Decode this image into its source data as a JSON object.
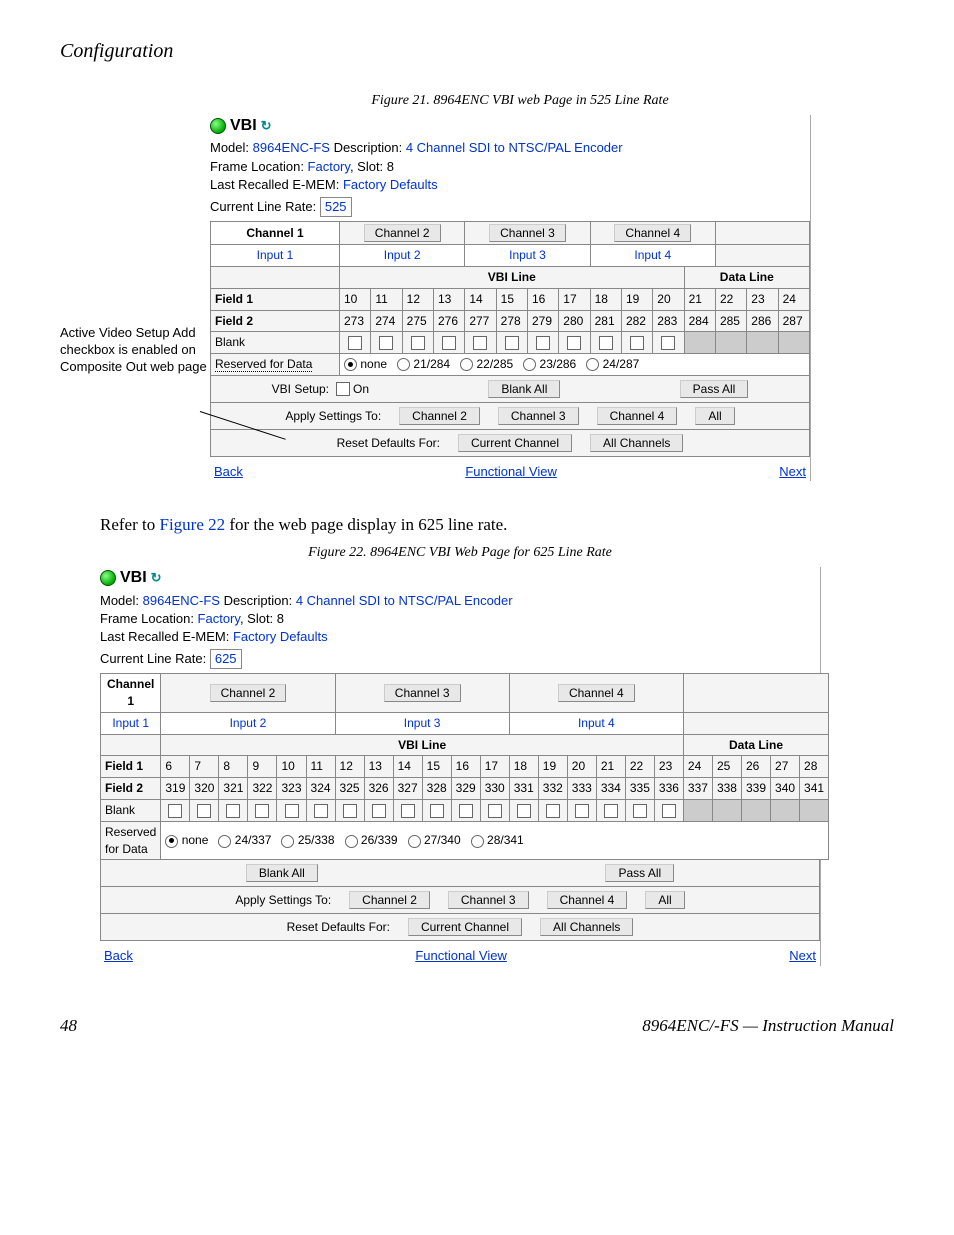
{
  "page": {
    "section": "Configuration",
    "page_num": "48",
    "manual_title": "8964ENC/-FS — Instruction Manual",
    "body_text_pre": "Refer to ",
    "body_text_link": "Figure 22",
    "body_text_post": " for the web page display in 625 line rate."
  },
  "callout": "Active Video Setup Add checkbox is enabled on Composite Out web page",
  "fig21": {
    "caption": "Figure 21.  8964ENC VBI web Page in 525 Line Rate",
    "title": "VBI",
    "model_label": "Model: ",
    "model_val": "8964ENC-FS",
    "desc_label": " Description: ",
    "desc_val": "4 Channel SDI to NTSC/PAL Encoder",
    "frame_label": "Frame Location: ",
    "frame_val": "Factory",
    "slot_label": ", Slot: ",
    "slot_val": "8",
    "emem_label": "Last Recalled E-MEM: ",
    "emem_val": "Factory Defaults",
    "rate_label": "Current Line Rate: ",
    "rate_val": "525",
    "channels": [
      "Channel 1",
      "Channel 2",
      "Channel 3",
      "Channel 4"
    ],
    "inputs": [
      "Input 1",
      "Input 2",
      "Input 3",
      "Input 4"
    ],
    "vbi_label": "VBI Line",
    "data_label": "Data Line",
    "field1_label": "Field 1",
    "field1": [
      "10",
      "11",
      "12",
      "13",
      "14",
      "15",
      "16",
      "17",
      "18",
      "19",
      "20",
      "21",
      "22",
      "23",
      "24"
    ],
    "field2_label": "Field 2",
    "field2": [
      "273",
      "274",
      "275",
      "276",
      "277",
      "278",
      "279",
      "280",
      "281",
      "282",
      "283",
      "284",
      "285",
      "286",
      "287"
    ],
    "blank_label": "Blank",
    "reserved_label": "Reserved for Data",
    "reserved_opts": [
      "none",
      "21/284",
      "22/285",
      "23/286",
      "24/287"
    ],
    "vbi_setup_label": "VBI Setup:",
    "vbi_setup_on": "On",
    "blank_all": "Blank All",
    "pass_all": "Pass All",
    "apply_label": "Apply Settings To:",
    "apply_btns": [
      "Channel 2",
      "Channel 3",
      "Channel 4",
      "All"
    ],
    "reset_label": "Reset Defaults For:",
    "reset_btns": [
      "Current Channel",
      "All Channels"
    ],
    "nav_back": "Back",
    "nav_func": "Functional View",
    "nav_next": "Next"
  },
  "fig22": {
    "caption": "Figure 22.  8964ENC VBI Web Page for 625 Line Rate",
    "title": "VBI",
    "model_label": "Model: ",
    "model_val": "8964ENC-FS",
    "desc_label": " Description: ",
    "desc_val": "4 Channel SDI to NTSC/PAL Encoder",
    "frame_label": "Frame Location: ",
    "frame_val": "Factory",
    "slot_label": ", Slot: ",
    "slot_val": "8",
    "emem_label": "Last Recalled E-MEM: ",
    "emem_val": "Factory Defaults",
    "rate_label": "Current Line Rate: ",
    "rate_val": "625",
    "channels": [
      "Channel 1",
      "Channel 2",
      "Channel 3",
      "Channel 4"
    ],
    "inputs": [
      "Input 1",
      "Input 2",
      "Input 3",
      "Input 4"
    ],
    "vbi_label": "VBI Line",
    "data_label": "Data Line",
    "field1_label": "Field 1",
    "field1": [
      "6",
      "7",
      "8",
      "9",
      "10",
      "11",
      "12",
      "13",
      "14",
      "15",
      "16",
      "17",
      "18",
      "19",
      "20",
      "21",
      "22",
      "23",
      "24",
      "25",
      "26",
      "27",
      "28"
    ],
    "field2_label": "Field 2",
    "field2": [
      "319",
      "320",
      "321",
      "322",
      "323",
      "324",
      "325",
      "326",
      "327",
      "328",
      "329",
      "330",
      "331",
      "332",
      "333",
      "334",
      "335",
      "336",
      "337",
      "338",
      "339",
      "340",
      "341"
    ],
    "blank_label": "Blank",
    "reserved_label": "Reserved for Data",
    "reserved_opts": [
      "none",
      "24/337",
      "25/338",
      "26/339",
      "27/340",
      "28/341"
    ],
    "blank_all": "Blank All",
    "pass_all": "Pass All",
    "apply_label": "Apply Settings To:",
    "apply_btns": [
      "Channel 2",
      "Channel 3",
      "Channel 4",
      "All"
    ],
    "reset_label": "Reset Defaults For:",
    "reset_btns": [
      "Current Channel",
      "All Channels"
    ],
    "nav_back": "Back",
    "nav_func": "Functional View",
    "nav_next": "Next"
  }
}
